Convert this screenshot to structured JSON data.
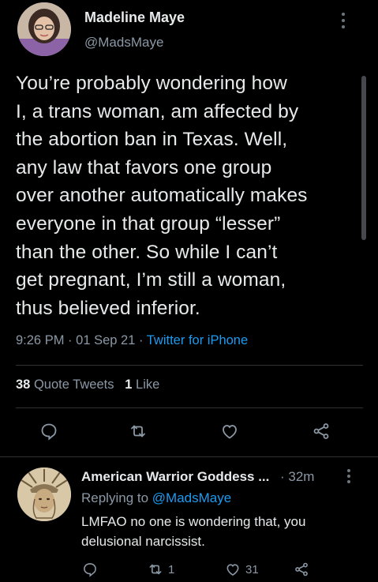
{
  "tweet": {
    "author_name": "Madeline Maye",
    "author_handle": "@MadsMaye",
    "text": "You’re probably wondering how\nI, a trans woman, am affected by\nthe abortion ban in Texas. Well,\nany law that favors one group\nover another automatically makes\neveryone in that group “lesser”\nthan the other. So while I can’t\nget pregnant, I’m still a woman,\nthus believed inferior.",
    "time": "9:26 PM",
    "date": "01 Sep 21",
    "source": "Twitter for iPhone",
    "separator": "·",
    "quote_tweets_count": "38",
    "quote_tweets_label": "Quote Tweets",
    "likes_count": "1",
    "likes_label": "Like",
    "actions": [
      "reply-icon",
      "retweet-icon",
      "like-icon",
      "share-icon"
    ]
  },
  "reply": {
    "author_name": "American Warrior Goddess ...",
    "time": "· 32m",
    "replying_prefix": "Replying to",
    "replying_handle": "@MadsMaye",
    "text": "LMFAO no one is wondering that, you delusional narcissist.",
    "retweets": "1",
    "likes": "31"
  },
  "colors": {
    "background": "#000000",
    "text": "#e7e9ea",
    "secondary": "#8b98a5",
    "link": "#1d9bf0",
    "divider": "#2f3336"
  }
}
